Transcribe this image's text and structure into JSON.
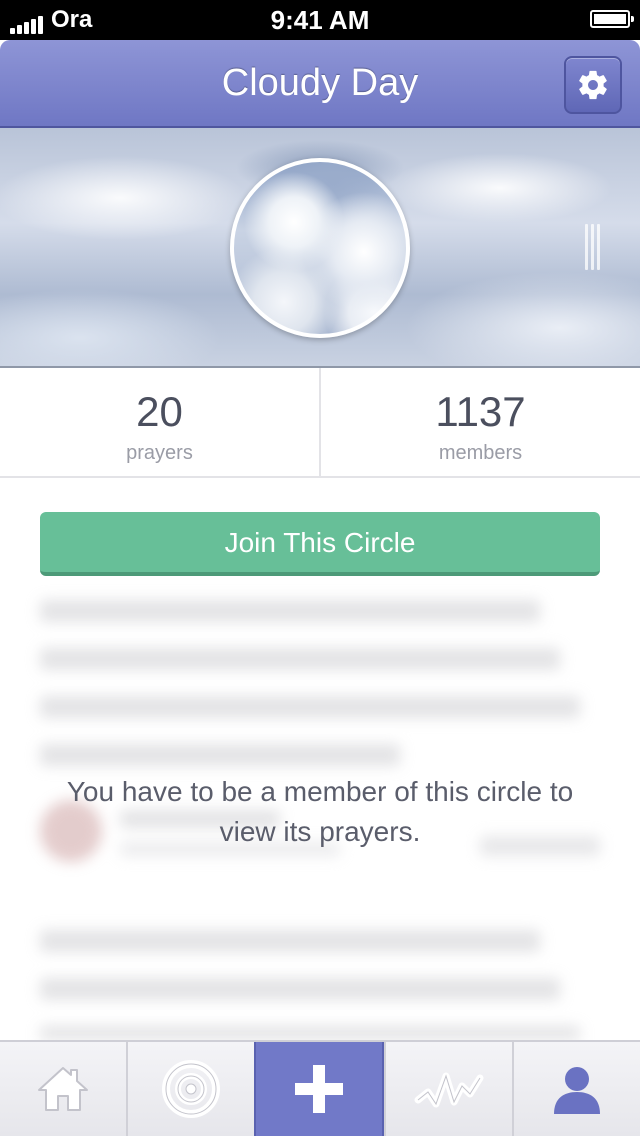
{
  "status_bar": {
    "carrier": "Ora",
    "time": "9:41 AM"
  },
  "nav": {
    "title": "Cloudy Day",
    "settings_icon": "gear-icon"
  },
  "stats": [
    {
      "value": "20",
      "label": "prayers"
    },
    {
      "value": "1137",
      "label": "members"
    }
  ],
  "join_button": {
    "label": "Join This Circle"
  },
  "message": "You have to be a member of this circle to view its prayers.",
  "tab_bar": {
    "tabs": [
      {
        "icon": "home-icon",
        "active": false
      },
      {
        "icon": "target-icon",
        "active": false
      },
      {
        "icon": "plus-icon",
        "active": true
      },
      {
        "icon": "activity-icon",
        "active": false
      },
      {
        "icon": "profile-icon",
        "active": false
      }
    ]
  },
  "colors": {
    "nav_accent": "#7179c8",
    "join_green": "#67bf98",
    "icon_gray": "#ffffff",
    "profile_icon": "#6a72c2"
  }
}
